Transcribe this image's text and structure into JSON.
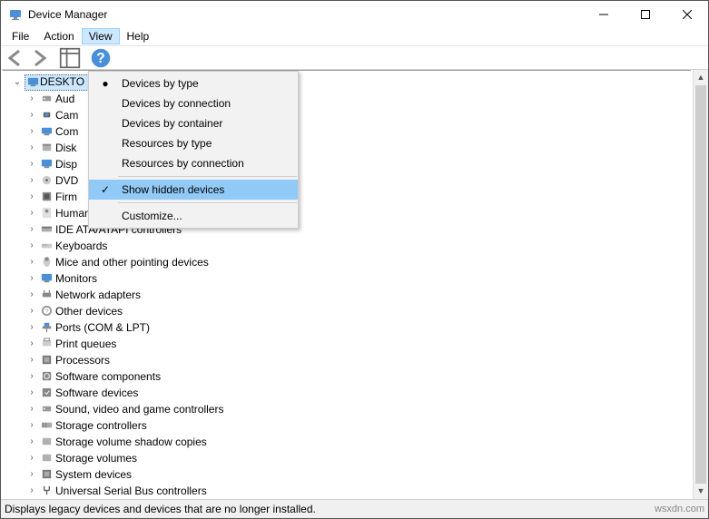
{
  "window": {
    "title": "Device Manager"
  },
  "menu": {
    "file": "File",
    "action": "Action",
    "view": "View",
    "help": "Help"
  },
  "dropdown": {
    "devices_by_type": "Devices by type",
    "devices_by_connection": "Devices by connection",
    "devices_by_container": "Devices by container",
    "resources_by_type": "Resources by type",
    "resources_by_connection": "Resources by connection",
    "show_hidden_devices": "Show hidden devices",
    "customize": "Customize..."
  },
  "tree": {
    "root": "DESKTO",
    "items": [
      "Aud",
      "Cam",
      "Com",
      "Disk",
      "Disp",
      "DVD",
      "Firm",
      "Human Interface Devices",
      "IDE ATA/ATAPI controllers",
      "Keyboards",
      "Mice and other pointing devices",
      "Monitors",
      "Network adapters",
      "Other devices",
      "Ports (COM & LPT)",
      "Print queues",
      "Processors",
      "Software components",
      "Software devices",
      "Sound, video and game controllers",
      "Storage controllers",
      "Storage volume shadow copies",
      "Storage volumes",
      "System devices",
      "Universal Serial Bus controllers"
    ]
  },
  "status": "Displays legacy devices and devices that are no longer installed.",
  "watermark": "wsxdn.com"
}
